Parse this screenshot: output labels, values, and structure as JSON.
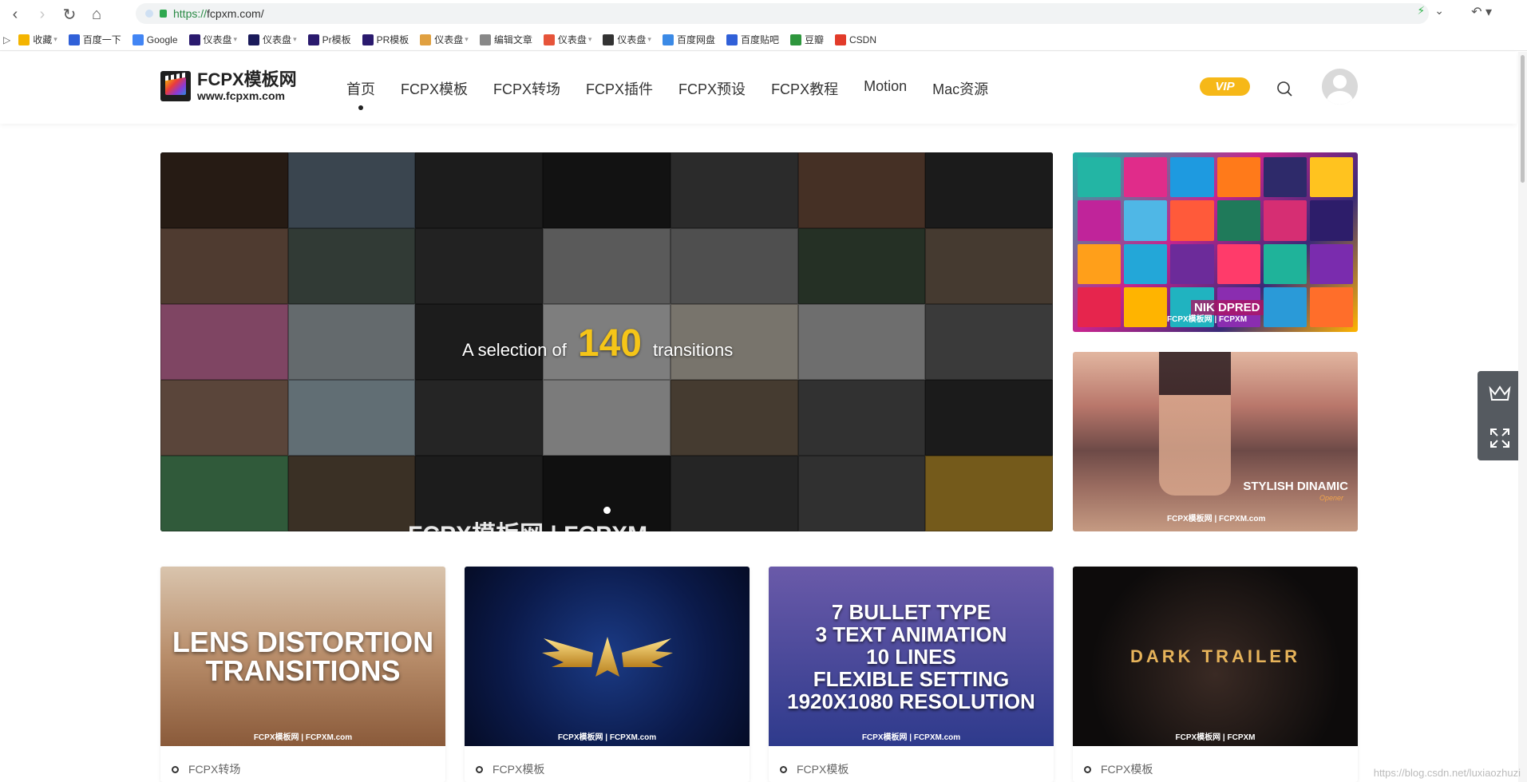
{
  "browser": {
    "url": "https://fcpxm.com/",
    "url_scheme": "https://",
    "url_rest": "fcpxm.com/",
    "bookmarks": [
      {
        "label": "收藏",
        "icon": "star-icon",
        "color": "#f4b400",
        "caret": true
      },
      {
        "label": "百度一下",
        "icon": "baidu-icon",
        "color": "#3060d8",
        "caret": false
      },
      {
        "label": "Google",
        "icon": "google-icon",
        "color": "#4285f4",
        "caret": false
      },
      {
        "label": "仪表盘",
        "icon": "pr-icon",
        "color": "#2a1a6e",
        "caret": true
      },
      {
        "label": "仪表盘",
        "icon": "ae-icon",
        "color": "#1a1a5a",
        "caret": true
      },
      {
        "label": "Pr模板",
        "icon": "pr-icon",
        "color": "#2a1a6e",
        "caret": false
      },
      {
        "label": "PR模板",
        "icon": "pr-icon",
        "color": "#2a1a6e",
        "caret": false
      },
      {
        "label": "仪表盘",
        "icon": "rainbow-icon",
        "color": "#e0a040",
        "caret": true
      },
      {
        "label": "编辑文章",
        "icon": "doc-icon",
        "color": "#888888",
        "caret": false
      },
      {
        "label": "仪表盘",
        "icon": "pr-round-icon",
        "color": "#e6543a",
        "caret": true
      },
      {
        "label": "仪表盘",
        "icon": "davinci-icon",
        "color": "#333333",
        "caret": true
      },
      {
        "label": "百度网盘",
        "icon": "cloud-icon",
        "color": "#3b8ae6",
        "caret": false
      },
      {
        "label": "百度贴吧",
        "icon": "tieba-icon",
        "color": "#3060d8",
        "caret": false
      },
      {
        "label": "豆瓣",
        "icon": "douban-icon",
        "color": "#2e963d",
        "caret": false
      },
      {
        "label": "CSDN",
        "icon": "csdn-icon",
        "color": "#e23b2a",
        "caret": false
      }
    ]
  },
  "header": {
    "logo_title": "FCPX模板网",
    "logo_sub": "www.fcpxm.com",
    "nav": [
      "首页",
      "FCPX模板",
      "FCPX转场",
      "FCPX插件",
      "FCPX预设",
      "FCPX教程",
      "Motion",
      "Mac资源"
    ],
    "active_nav": "首页",
    "vip_label": "VIP"
  },
  "slider": {
    "caption_pre": "A selection of",
    "caption_num": "140",
    "caption_post": "transitions",
    "bottom_text": "FCPX模板网 | FCPXM"
  },
  "side_banners": [
    {
      "watermark": "FCPX模板网 | FCPXM",
      "feature_text": "NIK DPRED"
    },
    {
      "title": "STYLISH DINAMIC",
      "subtitle": "Opener",
      "watermark": "FCPX模板网 | FCPXM.com"
    }
  ],
  "cards": [
    {
      "title_line1": "LENS DISTORTION",
      "title_line2": "TRANSITIONS",
      "watermark": "FCPX模板网 | FCPXM.com",
      "category": "FCPX转场"
    },
    {
      "title_line1": "",
      "title_line2": "",
      "watermark": "FCPX模板网 | FCPXM.com",
      "category": "FCPX模板"
    },
    {
      "title_line1": "7 BULLET TYPE",
      "title_line2": "3 TEXT ANIMATION",
      "title_line3": "10 LINES",
      "title_line4": "FLEXIBLE SETTING",
      "title_line5": "1920X1080 RESOLUTION",
      "watermark": "FCPX模板网 | FCPXM.com",
      "category": "FCPX模板"
    },
    {
      "title_line1": "DARK TRAILER",
      "watermark": "FCPX模板网 | FCPXM",
      "category": "FCPX模板"
    }
  ],
  "page_watermark": "https://blog.csdn.net/luxiaozhuzi"
}
